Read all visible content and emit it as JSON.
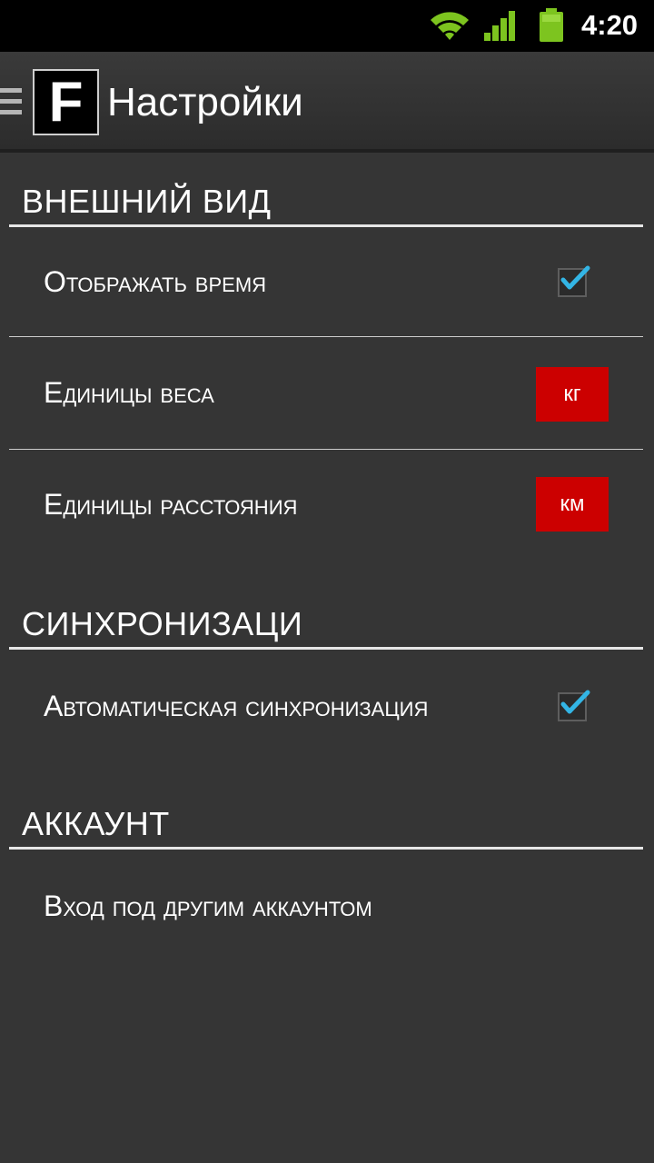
{
  "status_bar": {
    "time": "4:20",
    "icons": [
      "wifi-icon",
      "signal-icon",
      "battery-icon"
    ],
    "accent_color": "#7dc41f"
  },
  "action_bar": {
    "logo_letter": "F",
    "title": "Настройки"
  },
  "sections": {
    "appearance": {
      "header": "ВНЕШНИЙ ВИД",
      "show_time": {
        "label": "Отображать время",
        "checked": true
      },
      "weight_units": {
        "label": "Единицы веса",
        "value": "кг"
      },
      "distance_units": {
        "label": "Единицы расстояния",
        "value": "км"
      }
    },
    "sync": {
      "header": "СИНХРОНИЗАЦИ",
      "auto_sync": {
        "label": "Автоматическая синхронизация",
        "checked": true
      }
    },
    "account": {
      "header": "АККАУНТ",
      "switch_account": {
        "label": "Вход под другим аккаунтом"
      }
    }
  },
  "colors": {
    "background": "#353535",
    "value_button": "#cc0000",
    "checkmark": "#33b5e5"
  }
}
